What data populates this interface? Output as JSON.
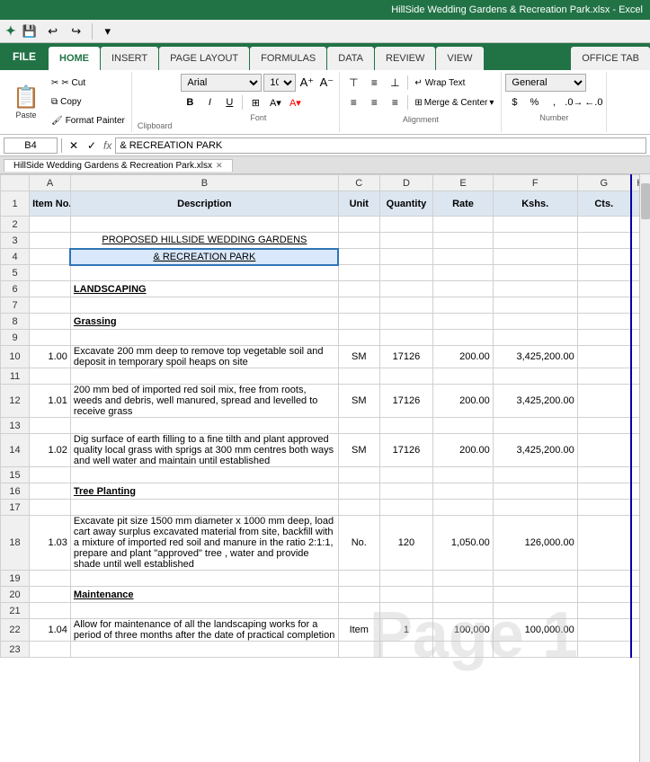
{
  "titleBar": {
    "title": "HillSide Wedding Gardens & Recreation Park.xlsx - Excel"
  },
  "quickAccess": {
    "save": "💾",
    "undo": "↩",
    "redo": "↪"
  },
  "tabs": [
    {
      "label": "FILE",
      "active": false
    },
    {
      "label": "HOME",
      "active": true
    },
    {
      "label": "INSERT",
      "active": false
    },
    {
      "label": "PAGE LAYOUT",
      "active": false
    },
    {
      "label": "FORMULAS",
      "active": false
    },
    {
      "label": "DATA",
      "active": false
    },
    {
      "label": "REVIEW",
      "active": false
    },
    {
      "label": "VIEW",
      "active": false
    },
    {
      "label": "OFFICE TAB",
      "active": false
    }
  ],
  "ribbon": {
    "clipboard": {
      "label": "Clipboard",
      "paste": "Paste",
      "cut": "✂ Cut",
      "copy": "Copy",
      "formatPainter": "Format Painter"
    },
    "font": {
      "label": "Font",
      "fontName": "Arial",
      "fontSize": "10",
      "bold": "B",
      "italic": "I",
      "underline": "U"
    },
    "alignment": {
      "label": "Alignment",
      "wrapText": "Wrap Text",
      "mergeCenter": "Merge & Center"
    },
    "number": {
      "label": "Number",
      "format": "General"
    }
  },
  "formulaBar": {
    "cellRef": "B4",
    "formula": "& RECREATION PARK"
  },
  "sheetTab": {
    "name": "HillSide Wedding Gardens & Recreation Park.xlsx",
    "close": "✕"
  },
  "columns": {
    "headers": [
      "A",
      "B",
      "C",
      "D",
      "E",
      "F",
      "G",
      "H"
    ],
    "widths": [
      40,
      260,
      40,
      50,
      55,
      80,
      55,
      20
    ]
  },
  "rows": [
    {
      "num": 1,
      "cells": [
        {
          "val": "Item\nNo.",
          "bold": true,
          "center": true
        },
        {
          "val": "Description",
          "bold": true,
          "center": true
        },
        {
          "val": "Unit",
          "bold": true,
          "center": true
        },
        {
          "val": "Quantity",
          "bold": true,
          "center": true
        },
        {
          "val": "Rate",
          "bold": true,
          "center": true
        },
        {
          "val": "Kshs.",
          "bold": true,
          "center": true
        },
        {
          "val": "Cts.",
          "bold": true,
          "center": true
        },
        {
          "val": ""
        }
      ]
    },
    {
      "num": 2,
      "cells": [
        {
          "val": ""
        },
        {
          "val": ""
        },
        {
          "val": ""
        },
        {
          "val": ""
        },
        {
          "val": ""
        },
        {
          "val": ""
        },
        {
          "val": ""
        },
        {
          "val": ""
        }
      ]
    },
    {
      "num": 3,
      "cells": [
        {
          "val": ""
        },
        {
          "val": "PROPOSED HILLSIDE WEDDING GARDENS",
          "bold": false,
          "underline": true,
          "center": true
        },
        {
          "val": ""
        },
        {
          "val": ""
        },
        {
          "val": ""
        },
        {
          "val": ""
        },
        {
          "val": ""
        },
        {
          "val": ""
        }
      ]
    },
    {
      "num": 4,
      "cells": [
        {
          "val": ""
        },
        {
          "val": "& RECREATION PARK",
          "underline": true,
          "center": true
        },
        {
          "val": ""
        },
        {
          "val": ""
        },
        {
          "val": ""
        },
        {
          "val": ""
        },
        {
          "val": ""
        },
        {
          "val": ""
        }
      ]
    },
    {
      "num": 5,
      "cells": [
        {
          "val": ""
        },
        {
          "val": ""
        },
        {
          "val": ""
        },
        {
          "val": ""
        },
        {
          "val": ""
        },
        {
          "val": ""
        },
        {
          "val": ""
        },
        {
          "val": ""
        }
      ]
    },
    {
      "num": 6,
      "cells": [
        {
          "val": ""
        },
        {
          "val": "LANDSCAPING",
          "bold": true,
          "underline": true
        },
        {
          "val": ""
        },
        {
          "val": ""
        },
        {
          "val": ""
        },
        {
          "val": ""
        },
        {
          "val": ""
        },
        {
          "val": ""
        }
      ]
    },
    {
      "num": 7,
      "cells": [
        {
          "val": ""
        },
        {
          "val": ""
        },
        {
          "val": ""
        },
        {
          "val": ""
        },
        {
          "val": ""
        },
        {
          "val": ""
        },
        {
          "val": ""
        },
        {
          "val": ""
        }
      ]
    },
    {
      "num": 8,
      "cells": [
        {
          "val": ""
        },
        {
          "val": "Grassing",
          "bold": true,
          "underline": true
        },
        {
          "val": ""
        },
        {
          "val": ""
        },
        {
          "val": ""
        },
        {
          "val": ""
        },
        {
          "val": ""
        },
        {
          "val": ""
        }
      ]
    },
    {
      "num": 9,
      "cells": [
        {
          "val": ""
        },
        {
          "val": ""
        },
        {
          "val": ""
        },
        {
          "val": ""
        },
        {
          "val": ""
        },
        {
          "val": ""
        },
        {
          "val": ""
        },
        {
          "val": ""
        }
      ]
    },
    {
      "num": 10,
      "cells": [
        {
          "val": "1.00",
          "right": true
        },
        {
          "val": "Excavate 200 mm deep to remove top vegetable soil and deposit in temporary spoil heaps on site",
          "wrap": true
        },
        {
          "val": "SM",
          "center": true
        },
        {
          "val": "17126",
          "center": true
        },
        {
          "val": "200.00",
          "right": true
        },
        {
          "val": "3,425,200.00",
          "right": true
        },
        {
          "val": ""
        },
        {
          "val": ""
        }
      ]
    },
    {
      "num": 11,
      "cells": [
        {
          "val": ""
        },
        {
          "val": ""
        },
        {
          "val": ""
        },
        {
          "val": ""
        },
        {
          "val": ""
        },
        {
          "val": ""
        },
        {
          "val": ""
        },
        {
          "val": ""
        }
      ]
    },
    {
      "num": 12,
      "cells": [
        {
          "val": "1.01",
          "right": true
        },
        {
          "val": "200 mm bed of imported red soil mix, free from roots, weeds and debris, well manured, spread and levelled to receive grass",
          "wrap": true
        },
        {
          "val": "SM",
          "center": true
        },
        {
          "val": "17126",
          "center": true
        },
        {
          "val": "200.00",
          "right": true
        },
        {
          "val": "3,425,200.00",
          "right": true
        },
        {
          "val": ""
        },
        {
          "val": ""
        }
      ]
    },
    {
      "num": 13,
      "cells": [
        {
          "val": ""
        },
        {
          "val": ""
        },
        {
          "val": ""
        },
        {
          "val": ""
        },
        {
          "val": ""
        },
        {
          "val": ""
        },
        {
          "val": ""
        },
        {
          "val": ""
        }
      ]
    },
    {
      "num": 14,
      "cells": [
        {
          "val": "1.02",
          "right": true
        },
        {
          "val": "Dig surface of earth filling to a fine tilth and plant approved quality local grass with sprigs at 300 mm centres both ways and well water and maintain until established",
          "wrap": true
        },
        {
          "val": "SM",
          "center": true
        },
        {
          "val": "17126",
          "center": true
        },
        {
          "val": "200.00",
          "right": true
        },
        {
          "val": "3,425,200.00",
          "right": true
        },
        {
          "val": ""
        },
        {
          "val": ""
        }
      ]
    },
    {
      "num": 15,
      "cells": [
        {
          "val": ""
        },
        {
          "val": ""
        },
        {
          "val": ""
        },
        {
          "val": ""
        },
        {
          "val": ""
        },
        {
          "val": ""
        },
        {
          "val": ""
        },
        {
          "val": ""
        }
      ]
    },
    {
      "num": 16,
      "cells": [
        {
          "val": ""
        },
        {
          "val": "Tree Planting",
          "bold": true,
          "underline": true
        },
        {
          "val": ""
        },
        {
          "val": ""
        },
        {
          "val": ""
        },
        {
          "val": ""
        },
        {
          "val": ""
        },
        {
          "val": ""
        }
      ]
    },
    {
      "num": 17,
      "cells": [
        {
          "val": ""
        },
        {
          "val": ""
        },
        {
          "val": ""
        },
        {
          "val": ""
        },
        {
          "val": ""
        },
        {
          "val": ""
        },
        {
          "val": ""
        },
        {
          "val": ""
        }
      ]
    },
    {
      "num": 18,
      "cells": [
        {
          "val": "1.03",
          "right": true
        },
        {
          "val": "Excavate pit size 1500 mm diameter x 1000 mm deep, load cart away surplus excavated material from site, backfill with a mixture of imported red soil and manure in the ratio 2:1:1, prepare and plant \"approved\" tree , water and provide shade until well established",
          "wrap": true
        },
        {
          "val": "No.",
          "center": true
        },
        {
          "val": "120",
          "center": true
        },
        {
          "val": "1,050.00",
          "right": true
        },
        {
          "val": "126,000.00",
          "right": true
        },
        {
          "val": ""
        },
        {
          "val": ""
        }
      ]
    },
    {
      "num": 19,
      "cells": [
        {
          "val": ""
        },
        {
          "val": ""
        },
        {
          "val": ""
        },
        {
          "val": ""
        },
        {
          "val": ""
        },
        {
          "val": ""
        },
        {
          "val": ""
        },
        {
          "val": ""
        }
      ]
    },
    {
      "num": 20,
      "cells": [
        {
          "val": ""
        },
        {
          "val": "Maintenance",
          "bold": true,
          "underline": true
        },
        {
          "val": ""
        },
        {
          "val": ""
        },
        {
          "val": ""
        },
        {
          "val": ""
        },
        {
          "val": ""
        },
        {
          "val": ""
        }
      ]
    },
    {
      "num": 21,
      "cells": [
        {
          "val": ""
        },
        {
          "val": ""
        },
        {
          "val": ""
        },
        {
          "val": ""
        },
        {
          "val": ""
        },
        {
          "val": ""
        },
        {
          "val": ""
        },
        {
          "val": ""
        }
      ]
    },
    {
      "num": 22,
      "cells": [
        {
          "val": "1.04",
          "right": true
        },
        {
          "val": "Allow for maintenance of all the landscaping works for a period of three months after the date of practical completion",
          "wrap": true
        },
        {
          "val": "Item",
          "center": true
        },
        {
          "val": "1",
          "center": true
        },
        {
          "val": "100,000",
          "right": true
        },
        {
          "val": "100,000.00",
          "right": true
        },
        {
          "val": ""
        },
        {
          "val": ""
        }
      ]
    },
    {
      "num": 23,
      "cells": [
        {
          "val": ""
        },
        {
          "val": ""
        },
        {
          "val": ""
        },
        {
          "val": ""
        },
        {
          "val": ""
        },
        {
          "val": ""
        },
        {
          "val": ""
        },
        {
          "val": ""
        }
      ]
    }
  ],
  "pageNumber": "1"
}
